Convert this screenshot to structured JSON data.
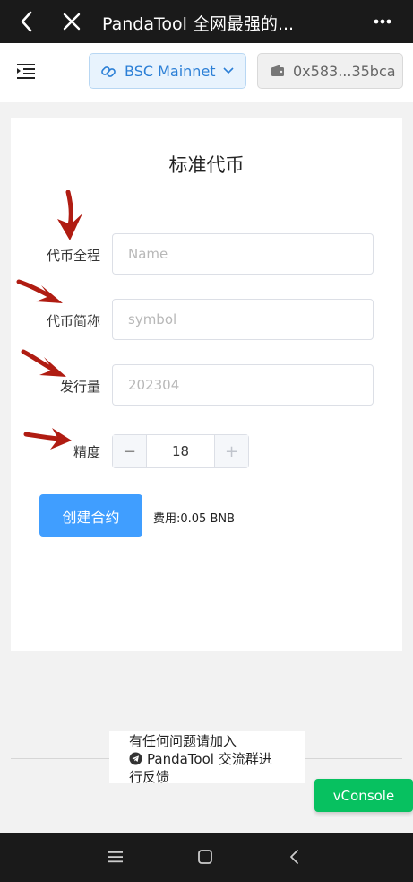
{
  "topbar": {
    "title": "PandaTool 全网最强的...",
    "icons": [
      "back-arrow-icon",
      "close-icon",
      "more-icon"
    ]
  },
  "header": {
    "network_label": "BSC Mainnet",
    "wallet_label": "0x583...35bca",
    "accent": "#2b7fd6"
  },
  "card": {
    "title": "标准代币",
    "fields": [
      {
        "label": "代币全程",
        "placeholder": "Name"
      },
      {
        "label": "代币简称",
        "placeholder": "symbol"
      },
      {
        "label": "发行量",
        "placeholder": "202304"
      }
    ],
    "decimals": {
      "label": "精度",
      "value": "18",
      "minus": "−",
      "plus": "+"
    },
    "create_label": "创建合约",
    "fee": "费用:0.05 BNB",
    "button_color": "#409eff",
    "annotation_arrow_color": "#b01c12"
  },
  "footer": {
    "line1": "有任何问题请加入",
    "tg_name": "PandaTool",
    "line2_rest": " 交流群进",
    "line3": "行反馈"
  },
  "vconsole_label": "vConsole"
}
